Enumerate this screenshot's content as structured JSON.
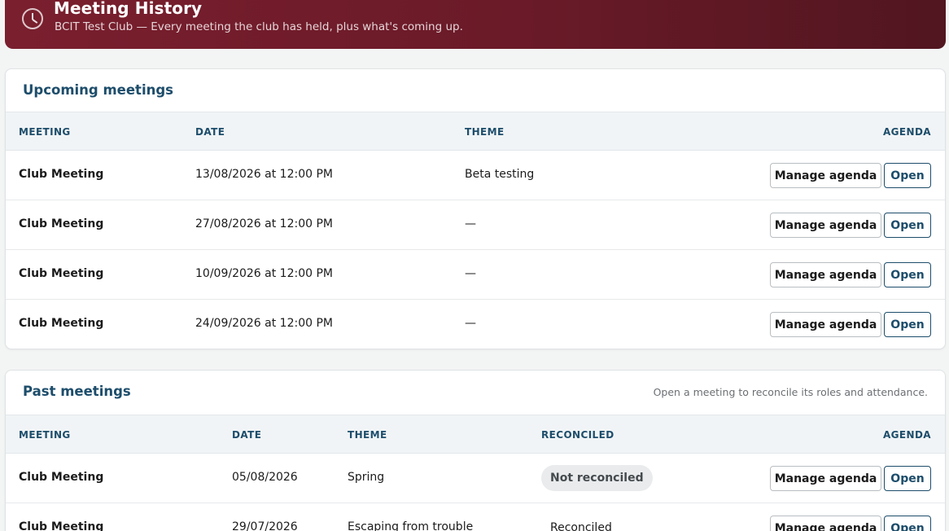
{
  "header": {
    "title": "Meeting History",
    "subtitle": "BCIT Test Club — Every meeting the club has held, plus what's coming up."
  },
  "upcoming": {
    "title": "Upcoming meetings",
    "columns": {
      "meeting": "MEETING",
      "date": "DATE",
      "theme": "THEME",
      "agenda": "AGENDA"
    },
    "rows": [
      {
        "meeting": "Club Meeting",
        "date": "13/08/2026 at 12:00 PM",
        "theme": "Beta testing",
        "manage": "Manage agenda",
        "open": "Open"
      },
      {
        "meeting": "Club Meeting",
        "date": "27/08/2026 at 12:00 PM",
        "theme": "—",
        "manage": "Manage agenda",
        "open": "Open"
      },
      {
        "meeting": "Club Meeting",
        "date": "10/09/2026 at 12:00 PM",
        "theme": "—",
        "manage": "Manage agenda",
        "open": "Open"
      },
      {
        "meeting": "Club Meeting",
        "date": "24/09/2026 at 12:00 PM",
        "theme": "—",
        "manage": "Manage agenda",
        "open": "Open"
      }
    ]
  },
  "past": {
    "title": "Past meetings",
    "note": "Open a meeting to reconcile its roles and attendance.",
    "columns": {
      "meeting": "MEETING",
      "date": "DATE",
      "theme": "THEME",
      "reconciled": "RECONCILED",
      "agenda": "AGENDA"
    },
    "rows": [
      {
        "meeting": "Club Meeting",
        "date": "05/08/2026",
        "theme": "Spring",
        "reconciled": "Not reconciled",
        "manage": "Manage agenda",
        "open": "Open"
      },
      {
        "meeting": "Club Meeting",
        "date": "29/07/2026",
        "theme": "Escaping from trouble",
        "reconciled": "Reconciled",
        "manage": "Manage agenda",
        "open": "Open"
      }
    ]
  }
}
